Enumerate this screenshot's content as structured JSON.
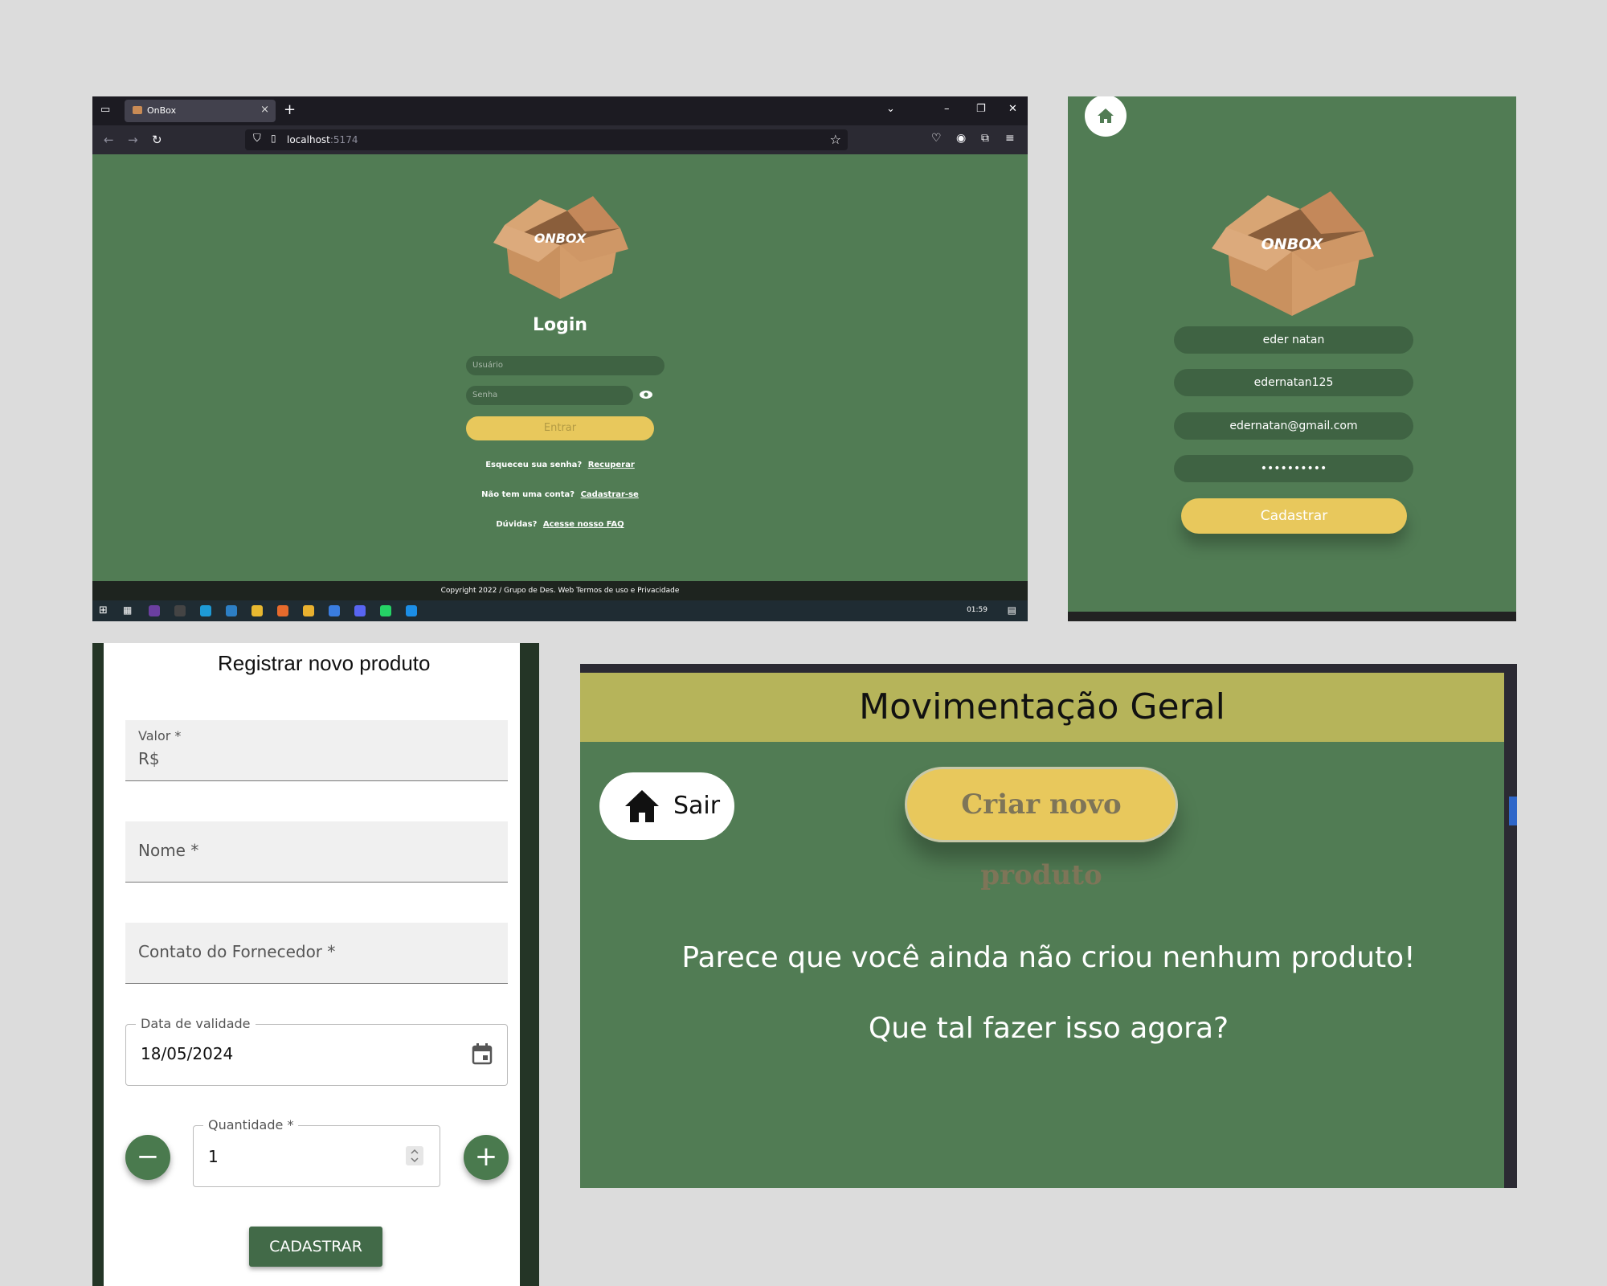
{
  "browser": {
    "tab_title": "OnBox",
    "tab_close": "×",
    "new_tab": "+",
    "url_host": "localhost",
    "url_port": ":5174",
    "logo_text": "ONBOX",
    "login_title": "Login",
    "username_placeholder": "Usuário",
    "password_placeholder": "Senha",
    "login_button": "Entrar",
    "forgot_text": "Esqueceu sua senha?",
    "forgot_link": "Recuperar",
    "no_account_text": "Não tem uma conta?",
    "no_account_link": "Cadastrar-se",
    "faq_text": "Dúvidas?",
    "faq_link": "Acesse nosso FAQ",
    "footer": "Copyright 2022 / Grupo de Des. Web Termos de uso e Privacidade",
    "clock": "01:59"
  },
  "register": {
    "logo_text": "ONBOX",
    "name_value": "eder natan",
    "username_value": "edernatan125",
    "email_value": "edernatan@gmail.com",
    "password_value": "••••••••••",
    "submit_button": "Cadastrar"
  },
  "product_form": {
    "heading": "Registrar novo produto",
    "valor_label": "Valor *",
    "valor_prefix": "R$",
    "nome_label": "Nome *",
    "contato_label": "Contato do Fornecedor *",
    "validade_label": "Data de validade",
    "validade_value": "18/05/2024",
    "quantidade_label": "Quantidade *",
    "quantidade_value": "1",
    "minus": "−",
    "plus": "+",
    "submit_button": "CADASTRAR"
  },
  "movement": {
    "title": "Movimentação Geral",
    "exit_button": "Sair",
    "create_button": "Criar novo produto",
    "empty_message": "Parece que você ainda não criou nenhum produto!",
    "prompt_message": "Que tal fazer isso agora?"
  },
  "colors": {
    "app_green": "#517c54",
    "input_green": "#3f6343",
    "accent_yellow": "#e8c85c",
    "header_olive": "#b6b45a"
  }
}
